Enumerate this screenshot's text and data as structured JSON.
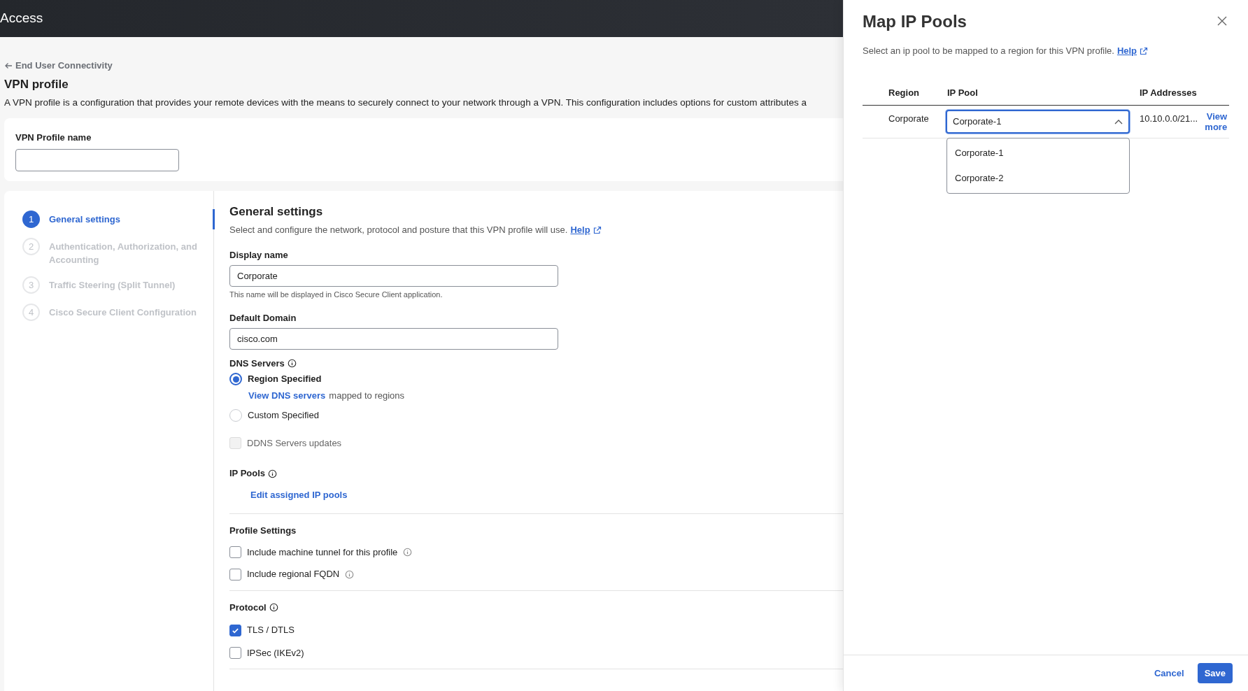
{
  "header": {
    "title": "Access"
  },
  "breadcrumb": {
    "label": "End User Connectivity"
  },
  "page": {
    "title": "VPN profile",
    "description": "A VPN profile is a configuration that provides your remote devices with the means to securely connect to your network through a VPN. This configuration includes options for custom attributes a"
  },
  "profile_name": {
    "label": "VPN Profile name"
  },
  "steps": [
    {
      "number": "1",
      "label": "General settings",
      "selected": true
    },
    {
      "number": "2",
      "label": "Authentication, Authorization, and Accounting",
      "selected": false
    },
    {
      "number": "3",
      "label": "Traffic Steering (Split Tunnel)",
      "selected": false
    },
    {
      "number": "4",
      "label": "Cisco Secure Client Configuration",
      "selected": false
    }
  ],
  "section": {
    "title": "General settings",
    "description": "Select and configure the network, protocol and posture that this VPN profile will use.",
    "help_link": "Help"
  },
  "display_name": {
    "label": "Display name",
    "value": "Corporate",
    "hint": "This name will be displayed in Cisco Secure Client application."
  },
  "default_domain": {
    "label": "Default Domain",
    "value": "cisco.com"
  },
  "dns_servers": {
    "label": "DNS Servers",
    "options": [
      {
        "label": "Region Specified",
        "selected": true,
        "link": "View DNS servers",
        "link_suffix": "mapped to regions"
      },
      {
        "label": "Custom Specified",
        "selected": false
      }
    ]
  },
  "ddns": {
    "label": "DDNS Servers updates",
    "checked": false,
    "disabled": true
  },
  "ip_pools": {
    "label": "IP Pools",
    "link": "Edit assigned IP pools"
  },
  "profile_settings": {
    "title": "Profile Settings",
    "options": [
      {
        "label": "Include machine tunnel for this profile",
        "checked": false
      },
      {
        "label": "Include regional FQDN",
        "checked": false
      }
    ]
  },
  "protocol": {
    "title": "Protocol",
    "options": [
      {
        "label": "TLS / DTLS",
        "checked": true
      },
      {
        "label": "IPSec (IKEv2)",
        "checked": false
      }
    ]
  },
  "drawer": {
    "title": "Map IP Pools",
    "description": "Select an ip pool to be mapped to a region for this VPN profile.",
    "help_link": "Help",
    "columns": [
      "Region",
      "IP Pool",
      "IP Addresses"
    ],
    "rows": [
      {
        "region": "Corporate",
        "ip_pool": "Corporate-1",
        "expanded": true,
        "ip_addresses": "10.10.0.0/21...",
        "view_more": "View more"
      }
    ],
    "pool_options": [
      {
        "label": "Corporate-1"
      },
      {
        "label": "Corporate-2"
      }
    ],
    "cancel": "Cancel",
    "save": "Save"
  }
}
